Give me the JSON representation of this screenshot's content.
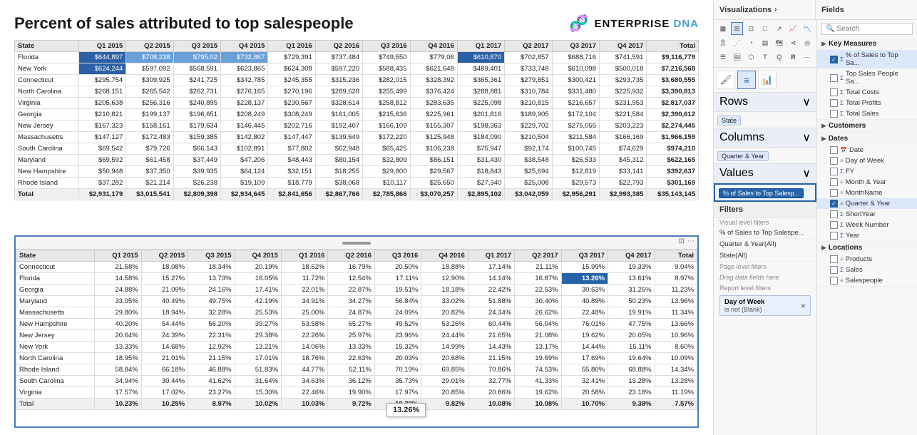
{
  "header": {
    "title": "Percent of sales attributed to top salespeople",
    "brand": "ENTERPRISE",
    "brand_accent": "DNA"
  },
  "top_table": {
    "columns": [
      "State",
      "Q1 2015",
      "Q2 2015",
      "Q3 2015",
      "Q4 2015",
      "Q1 2016",
      "Q2 2016",
      "Q3 2016",
      "Q4 2016",
      "Q1 2017",
      "Q2 2017",
      "Q3 2017",
      "Q4 2017",
      "Total"
    ],
    "rows": [
      [
        "Florida",
        "$644,897",
        "$708,238",
        "$795,02",
        "$732,867",
        "$729,391",
        "$737,484",
        "$749,550",
        "$779,06",
        "$610,870",
        "$702,857",
        "$688,716",
        "$741,591",
        "$9,116,779"
      ],
      [
        "New York",
        "$624,244",
        "$597,092",
        "$568,591",
        "$623,865",
        "$624,308",
        "$597,220",
        "$588,435",
        "$621,648",
        "$489,401",
        "$733,748",
        "$610,098",
        "$500,018",
        "$7,216,568"
      ],
      [
        "Connecticut",
        "$295,754",
        "$309,925",
        "$241,725",
        "$342,785",
        "$245,355",
        "$315,236",
        "$282,015",
        "$328,392",
        "$365,361",
        "$279,851",
        "$300,421",
        "$293,735",
        "$3,680,555"
      ],
      [
        "North Carolina",
        "$268,151",
        "$265,542",
        "$262,731",
        "$276,165",
        "$270,196",
        "$289,628",
        "$255,499",
        "$376,424",
        "$288,881",
        "$310,784",
        "$331,480",
        "$225,932",
        "$3,390,813"
      ],
      [
        "Virginia",
        "$205,638",
        "$256,316",
        "$240,895",
        "$228,137",
        "$230,567",
        "$328,614",
        "$258,812",
        "$283,635",
        "$225,098",
        "$210,815",
        "$216,657",
        "$231,953",
        "$2,817,037"
      ],
      [
        "Georgia",
        "$210,821",
        "$199,137",
        "$196,651",
        "$208,249",
        "$308,249",
        "$161,005",
        "$215,636",
        "$225,961",
        "$201,816",
        "$189,905",
        "$172,104",
        "$221,584",
        "$2,390,612"
      ],
      [
        "New Jersey",
        "$167,323",
        "$158,161",
        "$179,634",
        "$146,445",
        "$202,716",
        "$192,407",
        "$166,109",
        "$155,307",
        "$198,363",
        "$229,702",
        "$275,055",
        "$203,223",
        "$2,274,445"
      ],
      [
        "Massachusetts",
        "$147,127",
        "$172,483",
        "$159,385",
        "$142,802",
        "$147,447",
        "$139,649",
        "$172,220",
        "$125,948",
        "$184,090",
        "$210,504",
        "$211,584",
        "$166,169",
        "$1,966,159"
      ],
      [
        "South Carolina",
        "$69,542",
        "$79,726",
        "$66,143",
        "$102,891",
        "$77,802",
        "$62,948",
        "$65,425",
        "$106,238",
        "$75,947",
        "$92,174",
        "$100,745",
        "$74,629",
        "$974,210"
      ],
      [
        "Maryland",
        "$69,592",
        "$61,458",
        "$37,449",
        "$47,206",
        "$48,443",
        "$80,154",
        "$32,809",
        "$86,151",
        "$31,430",
        "$38,548",
        "$26,533",
        "$45,312",
        "$622,165"
      ],
      [
        "New Hampshire",
        "$50,948",
        "$37,350",
        "$39,935",
        "$64,124",
        "$32,151",
        "$18,255",
        "$29,800",
        "$29,567",
        "$18,843",
        "$25,694",
        "$12,819",
        "$33,141",
        "$392,637"
      ],
      [
        "Rhode Island",
        "$37,282",
        "$21,214",
        "$26,238",
        "$19,109",
        "$18,779",
        "$38,068",
        "$10,117",
        "$25,650",
        "$27,340",
        "$25,008",
        "$29,573",
        "$22,793",
        "$301,169"
      ],
      [
        "Total",
        "$2,931,179",
        "$3,015,541",
        "$2,809,398",
        "$2,934,645",
        "$2,841,656",
        "$2,867,766",
        "$2,785,866",
        "$3,070,257",
        "$2,895,102",
        "$3,042,059",
        "$2,956,291",
        "$2,993,385",
        "$35,143,145"
      ]
    ]
  },
  "bottom_table": {
    "columns": [
      "State",
      "Q1 2015",
      "Q2 2015",
      "Q3 2015",
      "Q4 2015",
      "Q1 2016",
      "Q2 2016",
      "Q3 2016",
      "Q4 2016",
      "Q1 2017",
      "Q2 2017",
      "Q3 2017",
      "Q4 2017",
      "Total"
    ],
    "rows": [
      [
        "Connecticut",
        "21.58%",
        "18.08%",
        "18.34%",
        "20.19%",
        "18.62%",
        "16.79%",
        "20.50%",
        "18.88%",
        "17.14%",
        "21.11%",
        "15.99%",
        "19.33%",
        "9.04%"
      ],
      [
        "Florida",
        "14.58%",
        "15.27%",
        "13.73%",
        "16.05%",
        "11.72%",
        "12.54%",
        "17.11%",
        "12.90%",
        "14.14%",
        "16.87%",
        "13.26%",
        "13.61%",
        "8.97%"
      ],
      [
        "Georgia",
        "24.88%",
        "21.09%",
        "24.16%",
        "17.41%",
        "22.01%",
        "22.87%",
        "19.51%",
        "18.18%",
        "22.42%",
        "22.53%",
        "30.63%",
        "31.25%",
        "11.23%"
      ],
      [
        "Maryland",
        "33.05%",
        "40.49%",
        "49.75%",
        "42.19%",
        "34.91%",
        "34.27%",
        "56.84%",
        "33.02%",
        "51.88%",
        "30.40%",
        "40.89%",
        "50.23%",
        "13.96%"
      ],
      [
        "Massachusetts",
        "29.80%",
        "18.94%",
        "32.28%",
        "25.53%",
        "25.00%",
        "24.87%",
        "24.09%",
        "20.82%",
        "24.34%",
        "26.62%",
        "22.48%",
        "19.91%",
        "11.34%"
      ],
      [
        "New Hampshire",
        "40.20%",
        "54.44%",
        "56.20%",
        "39.27%",
        "53.58%",
        "65.27%",
        "49.52%",
        "53.26%",
        "60.44%",
        "56.04%",
        "76.01%",
        "47.75%",
        "13.66%"
      ],
      [
        "New Jersey",
        "20.64%",
        "24.39%",
        "22.31%",
        "29.38%",
        "22.26%",
        "25.97%",
        "23.96%",
        "24.44%",
        "21.65%",
        "21.08%",
        "19.62%",
        "20.05%",
        "10.96%"
      ],
      [
        "New York",
        "13.33%",
        "14.68%",
        "12.92%",
        "13.21%",
        "14.06%",
        "13.33%",
        "15.32%",
        "14.99%",
        "14.43%",
        "13.17%",
        "14.44%",
        "15.11%",
        "8.60%"
      ],
      [
        "North Carolina",
        "18.95%",
        "21.01%",
        "21.15%",
        "17.01%",
        "18.76%",
        "22.63%",
        "20.03%",
        "20.68%",
        "21.15%",
        "19.69%",
        "17.69%",
        "19.64%",
        "10.09%"
      ],
      [
        "Rhode Island",
        "58.84%",
        "66.18%",
        "46.88%",
        "51.83%",
        "44.77%",
        "52.11%",
        "70.19%",
        "69.85%",
        "70.86%",
        "74.53%",
        "55.80%",
        "68.88%",
        "14.34%"
      ],
      [
        "South Carolina",
        "34.94%",
        "30.44%",
        "41.62%",
        "31.64%",
        "34.63%",
        "36.12%",
        "35.73%",
        "29.01%",
        "32.77%",
        "41.33%",
        "32.41%",
        "13.28%",
        "13.28%"
      ],
      [
        "Virginia",
        "17.57%",
        "17.02%",
        "23.27%",
        "15.30%",
        "22.46%",
        "19.90%",
        "17.97%",
        "20.85%",
        "20.86%",
        "19.62%",
        "20.58%",
        "23.18%",
        "11.19%"
      ],
      [
        "Total",
        "10.23%",
        "10.25%",
        "8.97%",
        "10.02%",
        "10.03%",
        "9.72%",
        "10.20%",
        "9.82%",
        "10.08%",
        "10.08%",
        "10.70%",
        "9.38%",
        "7.57%"
      ]
    ],
    "tooltip": "13.26%"
  },
  "right_panel": {
    "viz_title": "Visualizations",
    "fields_title": "Fields",
    "chevron": "›",
    "search_placeholder": "Search",
    "rows_label": "Rows",
    "columns_label": "Columns",
    "values_label": "Values",
    "filters_label": "Filters",
    "rows_field": "State",
    "columns_field": "Quarter & Year",
    "values_field": "% of Sales to Top Salesp...",
    "filters_title": "Filters",
    "visual_level_label": "Visual level filters",
    "visual_filter_1": "% of Sales to Top Salespe...",
    "visual_filter_2": "Quarter & Year(All)",
    "visual_filter_3": "State(All)",
    "page_level_label": "Page level filters",
    "drag_hint": "Drag data fields here",
    "report_level_label": "Report level filters",
    "dow_filter_label": "Day of Week",
    "dow_filter_sub": "is not (Blank)",
    "dow_filter_x": "×",
    "fields_groups": [
      {
        "name": "Key Measures",
        "items": [
          {
            "label": "% of Sales to Top Sa...",
            "type": "sigma",
            "checked": true
          },
          {
            "label": "Top Sales People Sa...",
            "type": "sigma",
            "checked": false
          },
          {
            "label": "Total Costs",
            "type": "sigma",
            "checked": false
          },
          {
            "label": "Total Profits",
            "type": "sigma",
            "checked": false
          },
          {
            "label": "Total Sales",
            "type": "sigma",
            "checked": false
          }
        ]
      },
      {
        "name": "Customers",
        "items": []
      },
      {
        "name": "Dates",
        "items": [
          {
            "label": "Date",
            "type": "calendar",
            "checked": false
          },
          {
            "label": "Day of Week",
            "type": "text",
            "checked": false
          },
          {
            "label": "FY",
            "type": "sigma",
            "checked": false
          },
          {
            "label": "Month & Year",
            "type": "text",
            "checked": false
          },
          {
            "label": "MonthName",
            "type": "text",
            "checked": false
          },
          {
            "label": "Quarter & Year",
            "type": "text",
            "checked": true
          },
          {
            "label": "ShortYear",
            "type": "sigma",
            "checked": false
          },
          {
            "label": "Week Number",
            "type": "sigma",
            "checked": false
          },
          {
            "label": "Year",
            "type": "sigma",
            "checked": false
          }
        ]
      },
      {
        "name": "Locations",
        "items": [
          {
            "label": "Products",
            "type": "text",
            "checked": false
          },
          {
            "label": "Sales",
            "type": "sigma",
            "checked": false
          },
          {
            "label": "Salespeople",
            "type": "text",
            "checked": false
          }
        ]
      }
    ],
    "toolbar_icons": [
      "↗",
      "≡",
      "⊞",
      "⊡",
      "📊",
      "📈",
      "📉",
      "🔢",
      "⋯",
      "⬜",
      "⬛",
      "⊕",
      "⊗",
      "🔧",
      "R",
      "⋮"
    ]
  }
}
